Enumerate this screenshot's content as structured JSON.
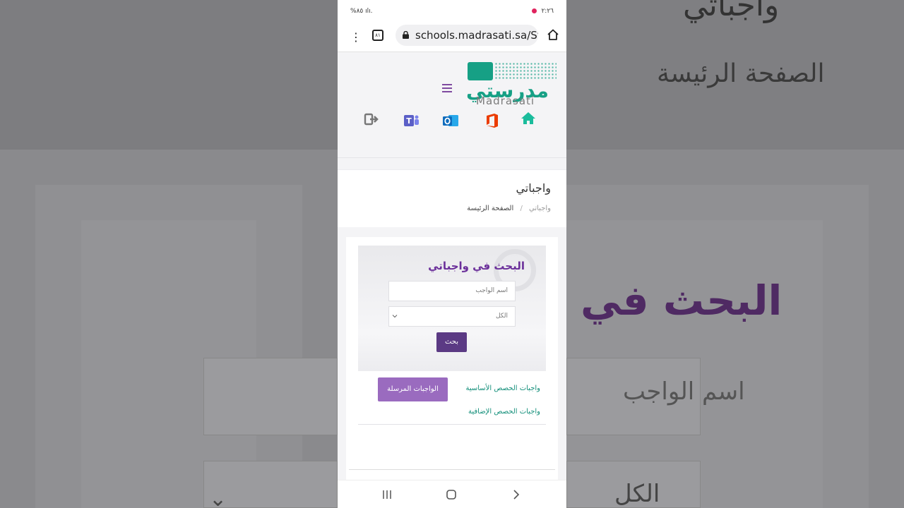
{
  "status_bar": {
    "left_text": "%٨٥ ılı.",
    "right_text": "٢:٢٦"
  },
  "browser": {
    "url": "schools.madrasati.sa/St",
    "tab_count": "٨١"
  },
  "header": {
    "logo_arabic": "مدرستي",
    "logo_english": "Madrasati",
    "icons": [
      "logout-icon",
      "teams-icon",
      "outlook-icon",
      "office-icon",
      "home-icon"
    ],
    "brand_color": "#16a085",
    "accent_color": "#6b2f9a"
  },
  "page": {
    "title": "واجباتي",
    "breadcrumb_home": "الصفحة الرئيسة",
    "breadcrumb_current": "واجباتي"
  },
  "search": {
    "title": "البحث في واجباتي",
    "name_placeholder": "اسم الواجب",
    "select_value": "الكل",
    "button_label": "بحث"
  },
  "tabs": {
    "basic": "واجبات الحصص الأساسية",
    "sent": "الواجبات المرسلة",
    "extra": "واجبات الحصص الإضافية"
  },
  "background": {
    "title": "واجباتي",
    "breadcrumb": "الصفحة الرئيسة",
    "search_title": "البحث في",
    "name_placeholder": "اسم الواجب",
    "select_value": "الكل"
  }
}
